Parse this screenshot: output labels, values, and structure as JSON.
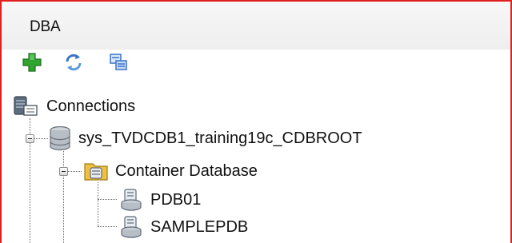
{
  "panel": {
    "title": "DBA"
  },
  "toolbar": {
    "buttons": [
      {
        "name": "add-connection-button",
        "icon": "green-plus-icon"
      },
      {
        "name": "refresh-button",
        "icon": "refresh-icon"
      },
      {
        "name": "filter-button",
        "icon": "filter-icon"
      }
    ]
  },
  "tree": {
    "root": {
      "label": "Connections",
      "icon": "connections-icon"
    },
    "connection": {
      "label": "sys_TVDCDB1_training19c_CDBROOT",
      "icon": "database-cylinder-icon",
      "expanded": true
    },
    "container": {
      "label": "Container Database",
      "icon": "container-folder-icon",
      "expanded": true
    },
    "pdbs": [
      {
        "label": "PDB01",
        "icon": "pdb-icon"
      },
      {
        "label": "SAMPLEPDB",
        "icon": "pdb-icon"
      }
    ]
  },
  "colors": {
    "border": "#e02020",
    "plus": "#2fa52f",
    "refresh": "#3a73c8",
    "folder": "#f0c040"
  }
}
